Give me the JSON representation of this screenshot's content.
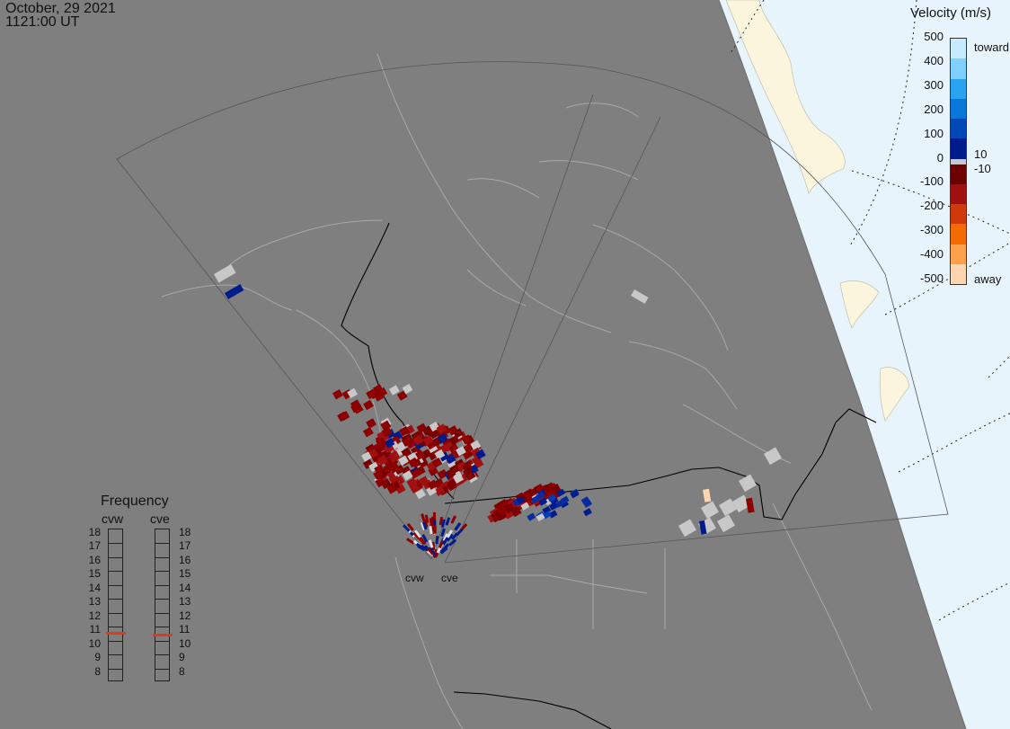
{
  "header": {
    "date": "October, 29 2021",
    "time": "1121:00 UT"
  },
  "colorbar": {
    "title": "Velocity (m/s)",
    "ticks": [
      "500",
      "400",
      "300",
      "200",
      "100",
      "0",
      "-100",
      "-200",
      "-300",
      "-400",
      "-500"
    ],
    "label_toward": "toward",
    "label_away": "away",
    "label_pos": "10",
    "label_neg": "-10",
    "colors": [
      "#c8eaff",
      "#80d0ff",
      "#2aa3ee",
      "#0a78d8",
      "#0048b8",
      "#001c8c",
      "#6b0000",
      "#a01010",
      "#d03a0a",
      "#f26a00",
      "#ffa04a",
      "#ffd6b0"
    ],
    "zero_band_color": "#c8c8c8"
  },
  "frequency": {
    "title": "Frequency",
    "radars": [
      "cvw",
      "cve"
    ],
    "scale": [
      "18",
      "17",
      "16",
      "15",
      "14",
      "13",
      "12",
      "11",
      "10",
      "9",
      "8"
    ],
    "selected_mhz": {
      "cvw": 11,
      "cve": 10.9
    },
    "marker_color": "#e03a1e"
  },
  "radar_labels": [
    "cvw",
    "cve"
  ],
  "map_colors": {
    "background": "#7f7f7f",
    "land_lines": "#a9a9a9",
    "daylight": "#e8f4fc",
    "daylight_land": "#faf5dc",
    "fov_outline": "#5a5a5a",
    "border_line": "#000000",
    "ground_scatter": "#c8c8c8"
  }
}
